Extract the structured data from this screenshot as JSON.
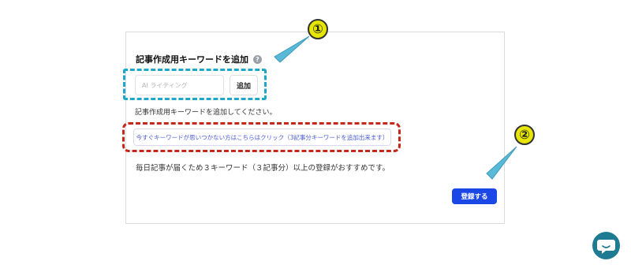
{
  "form": {
    "title": "記事作成用キーワードを追加",
    "help_icon": "?",
    "keyword_input": {
      "placeholder": "AI ライティング",
      "value": ""
    },
    "add_button": "追加",
    "hint": "記事作成用キーワードを追加してください。",
    "suggest_button": "今すぐキーワードが思いつかない方はこちらはクリック（3記事分キーワードを追加出来ます）",
    "recommendation": "毎日記事が届くため３キーワード（３記事分）以上の登録がおすすめです。",
    "register_button": "登録する"
  },
  "annotations": {
    "step1": "①",
    "step2": "②"
  },
  "colors": {
    "accent": "#1a47e6",
    "cyan_highlight": "#1fa6c9",
    "red_highlight": "#c4281c",
    "chat": "#1e7b92"
  },
  "icons": {
    "help": "question-icon",
    "chat": "chat-bubble-icon"
  }
}
